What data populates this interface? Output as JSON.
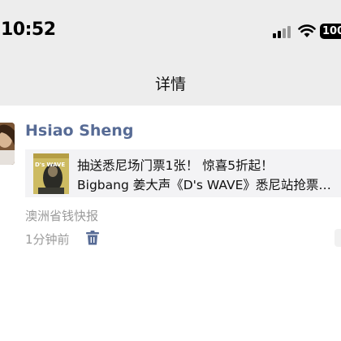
{
  "status_bar": {
    "time": "10:52",
    "battery_text": "100"
  },
  "nav": {
    "title": "详情"
  },
  "post": {
    "author": "Hsiao Sheng",
    "shared_article": {
      "title": "抽送悉尼场门票1张！ 惊喜5折起！",
      "description": "Bigbang 姜大声《D's WAVE》悉尼站抢票全攻略",
      "thumbnail_text": "D's WAVE"
    },
    "source": "澳洲省钱快报",
    "time_ago": "1分钟前"
  },
  "colors": {
    "header_bg": "#ededed",
    "author_link": "#576b95",
    "card_bg": "#f3f3f5",
    "meta_text": "#9b9b9b"
  },
  "icons": [
    "signal-icon",
    "wifi-icon",
    "battery-icon",
    "trash-icon"
  ]
}
